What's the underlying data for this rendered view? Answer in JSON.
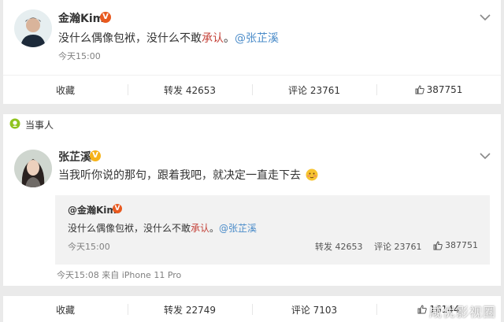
{
  "post1": {
    "author": "金瀚Kim",
    "text_before": "没什么偶像包袱，没什么不敢",
    "text_highlight": "承认",
    "text_after": "。",
    "mention": "@张芷溪",
    "time": "今天15:00",
    "actions": {
      "collect": "收藏",
      "forward": "转发 42653",
      "comment": "评论 23761",
      "like": "387751"
    }
  },
  "section_label": "当事人",
  "post2": {
    "author": "张芷溪",
    "text": "当我听你说的那句，跟着我吧，就决定一直走下去",
    "repost": {
      "author": "@金瀚Kim",
      "text_before": "没什么偶像包袱，没什么不敢",
      "text_highlight": "承认",
      "text_after": "。",
      "mention": "@张芷溪",
      "time": "今天15:00",
      "forward": "转发 42653",
      "comment": "评论 23761",
      "like": "387751"
    },
    "time_source": "今天15:08 来自 iPhone 11 Pro",
    "actions": {
      "collect": "收藏",
      "forward": "转发 22749",
      "comment": "评论 7103",
      "like": "16144"
    }
  },
  "watermark": "咸优影视圈",
  "colors": {
    "highlight": "#c5433a",
    "link": "#4b8cc9",
    "badge_red": "#e8591f",
    "badge_gold": "#f6b31a"
  }
}
